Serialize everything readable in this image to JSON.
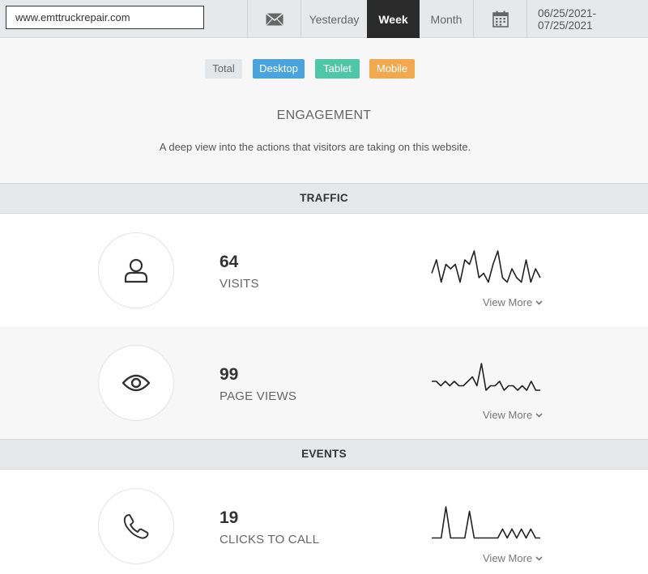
{
  "topbar": {
    "url": "www.emttruckrepair.com",
    "mail_icon": "mail-icon",
    "periods": [
      "Yesterday",
      "Week",
      "Month"
    ],
    "active_period": "Week",
    "calendar_icon": "calendar-icon",
    "date_range": "06/25/2021-07/25/2021"
  },
  "filters": {
    "total": "Total",
    "desktop": "Desktop",
    "tablet": "Tablet",
    "mobile": "Mobile",
    "colors": {
      "total": "#e4e7ea",
      "desktop": "#4ba3dd",
      "tablet": "#4fc6a5",
      "mobile": "#f2a84e"
    }
  },
  "engagement": {
    "title": "ENGAGEMENT",
    "description": "A deep view into the actions that visitors are taking on this website."
  },
  "sections": {
    "traffic": "TRAFFIC",
    "events": "EVENTS"
  },
  "metrics": [
    {
      "icon": "user-icon",
      "value": "64",
      "label": "VISITS",
      "view_more": "View More",
      "spark": [
        3,
        6,
        1,
        5,
        4,
        5,
        1,
        6,
        5,
        8,
        2,
        3,
        1,
        5,
        8,
        2,
        1,
        4,
        2,
        1,
        6,
        1,
        4,
        2
      ]
    },
    {
      "icon": "eye-icon",
      "value": "99",
      "label": "PAGE VIEWS",
      "view_more": "View More",
      "spark": [
        4,
        4,
        3,
        4,
        3,
        4,
        3,
        3,
        4,
        5,
        3,
        8,
        2,
        3,
        3,
        4,
        2,
        3,
        3,
        2,
        3,
        2,
        4,
        2,
        2
      ]
    },
    {
      "icon": "phone-icon",
      "value": "19",
      "label": "CLICKS TO CALL",
      "view_more": "View More",
      "spark": [
        1,
        1,
        1,
        8,
        1,
        1,
        1,
        1,
        7,
        1,
        1,
        1,
        1,
        1,
        1,
        3,
        1,
        3,
        1,
        3,
        1,
        3,
        1,
        1
      ]
    }
  ]
}
